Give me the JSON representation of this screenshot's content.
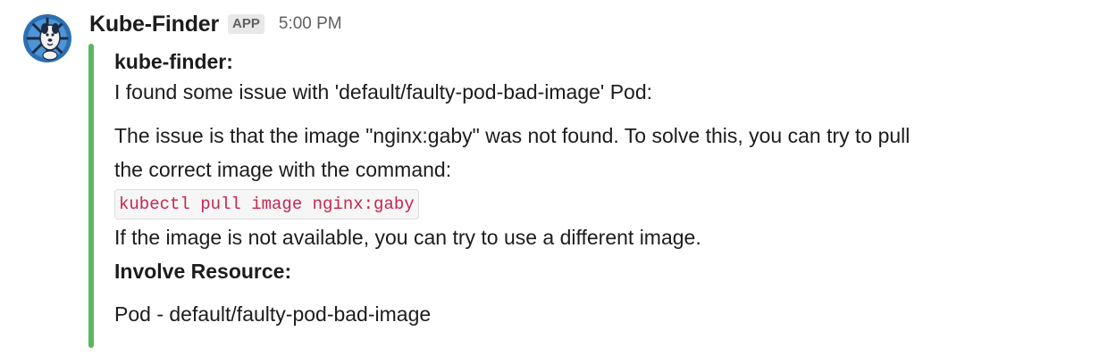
{
  "message": {
    "sender": "Kube-Finder",
    "badge": "APP",
    "timestamp": "5:00 PM",
    "attachment": {
      "bar_color": "#5cb85c",
      "bot_label": "kube-finder:",
      "summary": "I found some issue with 'default/faulty-pod-bad-image' Pod:",
      "issue_line_1": "The issue is that the image \"nginx:gaby\" was not found. To solve this, you can try to pull",
      "issue_line_2": "the correct image with the command:",
      "command": "kubectl pull image nginx:gaby",
      "fallback": "If the image is not available, you can try to use a different image.",
      "resource_heading": "Involve Resource:",
      "resource_value": "Pod - default/faulty-pod-bad-image"
    }
  },
  "avatar": {
    "icon": "kubernetes-dog-avatar-icon",
    "wheel_color": "#3b82c4",
    "dark_color": "#1f2a44"
  }
}
